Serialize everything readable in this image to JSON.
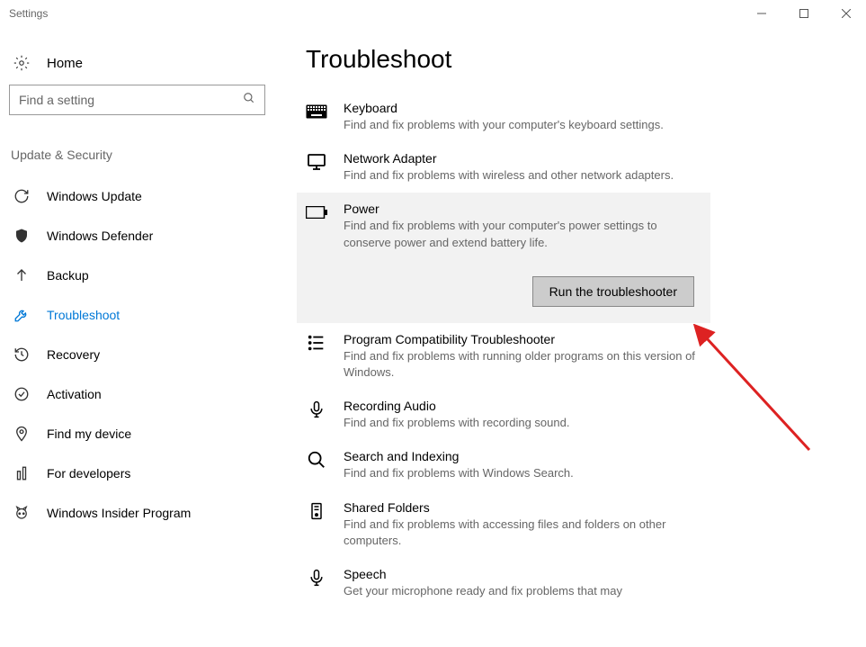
{
  "window": {
    "title": "Settings"
  },
  "sidebar": {
    "home_label": "Home",
    "search_placeholder": "Find a setting",
    "section_title": "Update & Security",
    "items": [
      {
        "label": "Windows Update"
      },
      {
        "label": "Windows Defender"
      },
      {
        "label": "Backup"
      },
      {
        "label": "Troubleshoot"
      },
      {
        "label": "Recovery"
      },
      {
        "label": "Activation"
      },
      {
        "label": "Find my device"
      },
      {
        "label": "For developers"
      },
      {
        "label": "Windows Insider Program"
      }
    ]
  },
  "page": {
    "title": "Troubleshoot"
  },
  "troubleshooters": [
    {
      "title": "Keyboard",
      "desc": "Find and fix problems with your computer's keyboard settings."
    },
    {
      "title": "Network Adapter",
      "desc": "Find and fix problems with wireless and other network adapters."
    },
    {
      "title": "Power",
      "desc": "Find and fix problems with your computer's power settings to conserve power and extend battery life.",
      "run_label": "Run the troubleshooter"
    },
    {
      "title": "Program Compatibility Troubleshooter",
      "desc": "Find and fix problems with running older programs on this version of Windows."
    },
    {
      "title": "Recording Audio",
      "desc": "Find and fix problems with recording sound."
    },
    {
      "title": "Search and Indexing",
      "desc": "Find and fix problems with Windows Search."
    },
    {
      "title": "Shared Folders",
      "desc": "Find and fix problems with accessing files and folders on other computers."
    },
    {
      "title": "Speech",
      "desc": "Get your microphone ready and fix problems that may"
    }
  ]
}
